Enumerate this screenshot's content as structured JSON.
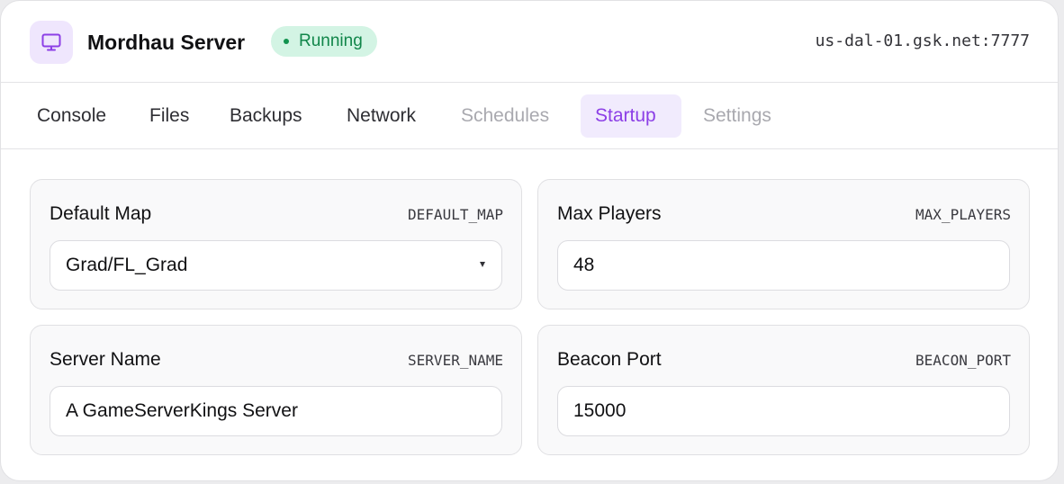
{
  "header": {
    "icon": "monitor-icon",
    "title": "Mordhau Server",
    "status": {
      "label": "Running",
      "color": "#11864a",
      "background": "#d3f4e4"
    },
    "address": "us-dal-01.gsk.net:7777"
  },
  "tabs": [
    {
      "label": "Console",
      "state": "normal"
    },
    {
      "label": "Files",
      "state": "normal"
    },
    {
      "label": "Backups",
      "state": "normal"
    },
    {
      "label": "Network",
      "state": "normal"
    },
    {
      "label": "Schedules",
      "state": "disabled"
    },
    {
      "label": "Startup",
      "state": "active"
    },
    {
      "label": "Settings",
      "state": "disabled"
    }
  ],
  "variables": {
    "default_map": {
      "label": "Default Map",
      "env": "DEFAULT_MAP",
      "value": "Grad/FL_Grad",
      "control": "select"
    },
    "max_players": {
      "label": "Max Players",
      "env": "MAX_PLAYERS",
      "value": "48",
      "control": "input"
    },
    "server_name": {
      "label": "Server Name",
      "env": "SERVER_NAME",
      "value": "A GameServerKings Server",
      "control": "input"
    },
    "beacon_port": {
      "label": "Beacon Port",
      "env": "BEACON_PORT",
      "value": "15000",
      "control": "input"
    }
  },
  "colors": {
    "accent": "#8c3fe6",
    "accent_background": "#f1ebfd",
    "icon_tile": "#efe6fd"
  }
}
